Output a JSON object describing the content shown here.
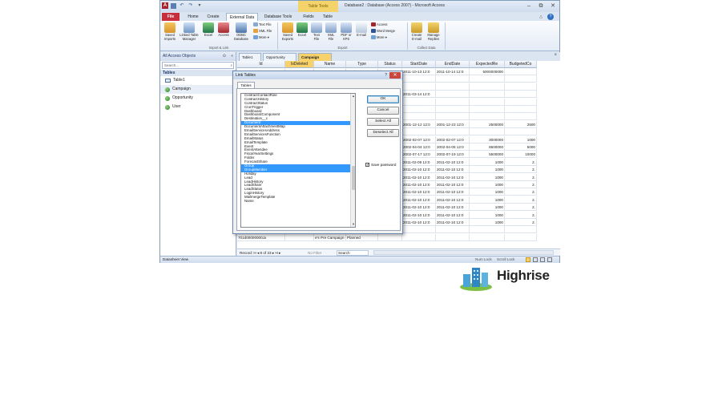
{
  "window": {
    "title": "Database2 : Database (Access 2007) - Microsoft Access",
    "context_tab": "Table Tools",
    "minimize": "–",
    "restore": "⧉",
    "close": "✕"
  },
  "ribbon": {
    "tabs": [
      "File",
      "Home",
      "Create",
      "External Data",
      "Database Tools",
      "Fields",
      "Table"
    ],
    "buttons": {
      "saved_imports": "Saved Imports",
      "linked_table_manager": "Linked Table Manager",
      "excel": "Excel",
      "access": "Access",
      "odbc": "ODBC Database",
      "text_file": "Text File",
      "xml_file": "XML File",
      "more_import": "More ▾",
      "saved_exports": "Saved Exports",
      "excel_export": "Excel",
      "text_file_export": "Text File",
      "xml_file_export": "XML File",
      "pdf_xps": "PDF or XPS",
      "email": "E-mail",
      "access_export": "Access",
      "word_merge": "Word Merge",
      "more_export": "More ▾",
      "create_email": "Create E-mail",
      "manage_replies": "Manage Replies"
    },
    "groups": {
      "import_link": "Import & Link",
      "export": "Export",
      "collect_data": "Collect Data"
    }
  },
  "nav": {
    "header": "All Access Objects",
    "search_placeholder": "Search...",
    "group": "Tables",
    "items": [
      "Table1",
      "Campaign",
      "Opportunity",
      "User"
    ]
  },
  "doc_tabs": [
    "Table1",
    "Opportunity",
    "Campaign"
  ],
  "grid": {
    "headers": [
      "Id",
      "IsDeleted",
      "Name",
      "Type",
      "Status",
      "StartDate",
      "EndDate",
      "ExpectedRe",
      "BudgetedCo"
    ],
    "rows": [
      [
        "",
        "",
        "",
        "",
        "d",
        "2011-10-13 12:0",
        "2011-10-14 12:0",
        "5000000000",
        ""
      ],
      [
        "",
        "",
        "",
        "",
        "d",
        "",
        "",
        "",
        ""
      ],
      [
        "",
        "",
        "",
        "",
        "d",
        "",
        "",
        "",
        ""
      ],
      [
        "",
        "",
        "",
        "",
        "d",
        "2011-03-14 12:0",
        "",
        "",
        ""
      ],
      [
        "",
        "",
        "",
        "",
        "d",
        "",
        "",
        "",
        ""
      ],
      [
        "",
        "",
        "",
        "",
        "d",
        "",
        "",
        "",
        ""
      ],
      [
        "",
        "",
        "",
        "",
        "d",
        "",
        "",
        "",
        ""
      ],
      [
        "",
        "",
        "",
        "",
        "ated",
        "2001-12-12 12:0",
        "2001-12-23 12:0",
        "2500000",
        "2500"
      ],
      [
        "",
        "",
        "",
        "",
        "d",
        "",
        "",
        "",
        ""
      ],
      [
        "",
        "",
        "",
        "",
        "ated",
        "2002-02-07 12:0",
        "2002-02-07 12:0",
        "3000000",
        "1000"
      ],
      [
        "",
        "",
        "",
        "",
        "d",
        "2002-04-04 12:0",
        "2002-04-05 12:0",
        "8500000",
        "5000"
      ],
      [
        "",
        "",
        "",
        "",
        "d",
        "2002-07-17 12:0",
        "2002-07-19 12:0",
        "5500000",
        "10000"
      ],
      [
        "",
        "",
        "",
        "",
        "ue",
        "2011-02-09 12:0",
        "2011-02-10 12:0",
        "1000",
        "2."
      ],
      [
        "",
        "",
        "",
        "",
        "ue",
        "2011-02-10 12:0",
        "2011-02-10 12:0",
        "1000",
        "2."
      ],
      [
        "",
        "",
        "",
        "",
        "ue",
        "2011-02-10 12:0",
        "2011-02-10 12:0",
        "1000",
        "2."
      ],
      [
        "",
        "",
        "",
        "",
        "ue",
        "2011-02-10 12:0",
        "2011-02-10 12:0",
        "1000",
        "2."
      ],
      [
        "",
        "",
        "",
        "",
        "ue",
        "2011-02-10 12:0",
        "2011-02-10 12:0",
        "1000",
        "2."
      ],
      [
        "",
        "",
        "",
        "",
        "ue",
        "2011-02-10 12:0",
        "2011-02-10 12:0",
        "1000",
        "2."
      ],
      [
        "",
        "",
        "",
        "",
        "ue",
        "2011-02-10 12:0",
        "2011-02-10 12:0",
        "1000",
        "2."
      ],
      [
        "",
        "",
        "",
        "",
        "ue",
        "2011-02-10 12:0",
        "2011-02-10 12:0",
        "1000",
        "2."
      ],
      [
        "",
        "",
        "",
        "",
        "ue",
        "2011-02-10 12:0",
        "2011-02-10 12:0",
        "1000",
        "2."
      ],
      [
        "",
        "",
        "",
        "",
        "",
        "",
        "",
        "",
        ""
      ],
      [
        "701d00000000Jx",
        "",
        "e's Pre Campaign Conversation",
        "Planned",
        "",
        "",
        "",
        "",
        ""
      ]
    ]
  },
  "record_nav": {
    "label": "Record: H ◂ 9 of 23 ▸ H ▸",
    "filter": "No Filter",
    "search": "Search"
  },
  "status_bar": {
    "view": "Datasheet View",
    "num_lock": "Num Lock",
    "scroll_lock": "Scroll Lock"
  },
  "dialog": {
    "title": "Link Tables",
    "help": "?",
    "close": "✕",
    "tab": "Tables",
    "ok": "OK",
    "cancel": "Cancel",
    "select_all": "Select All",
    "deselect_all": "Deselect All",
    "save_password": "Save password",
    "tables": [
      "ContractContactRole",
      "ContractHistory",
      "ContractStatus",
      "CronTrigger",
      "Dashboard",
      "DashboardComponent",
      "Destination__c",
      "Document",
      "DocumentAttachmentMap",
      "EmailServicesAddress",
      "EmailServicesFunction",
      "EmailStatus",
      "EmailTemplate",
      "Event",
      "EventAttendee",
      "FiscalYearSettings",
      "Folder",
      "ForecastShare",
      "Group",
      "GroupMember",
      "Holiday",
      "Lead",
      "LeadHistory",
      "LeadShare",
      "LeadStatus",
      "LoginHistory",
      "MailmergeTemplate",
      "Name"
    ],
    "selected": [
      "Document",
      "Group",
      "GroupMember"
    ]
  },
  "logo": {
    "text": "Highrise"
  }
}
